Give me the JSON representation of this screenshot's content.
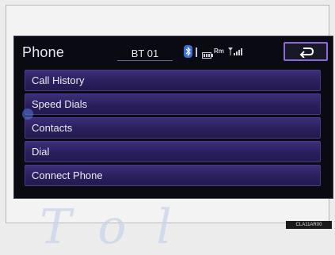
{
  "header": {
    "title": "Phone",
    "device_name": "BT 01",
    "roaming_label": "Rm",
    "back_icon": "back-arrow-icon"
  },
  "status_icons": [
    "bluetooth-icon",
    "battery-icon",
    "signal-icon"
  ],
  "menu": {
    "items": [
      {
        "label": "Call History"
      },
      {
        "label": "Speed Dials"
      },
      {
        "label": "Contacts"
      },
      {
        "label": "Dial"
      },
      {
        "label": "Connect Phone"
      }
    ]
  },
  "figure_code": "CLA11AR00"
}
